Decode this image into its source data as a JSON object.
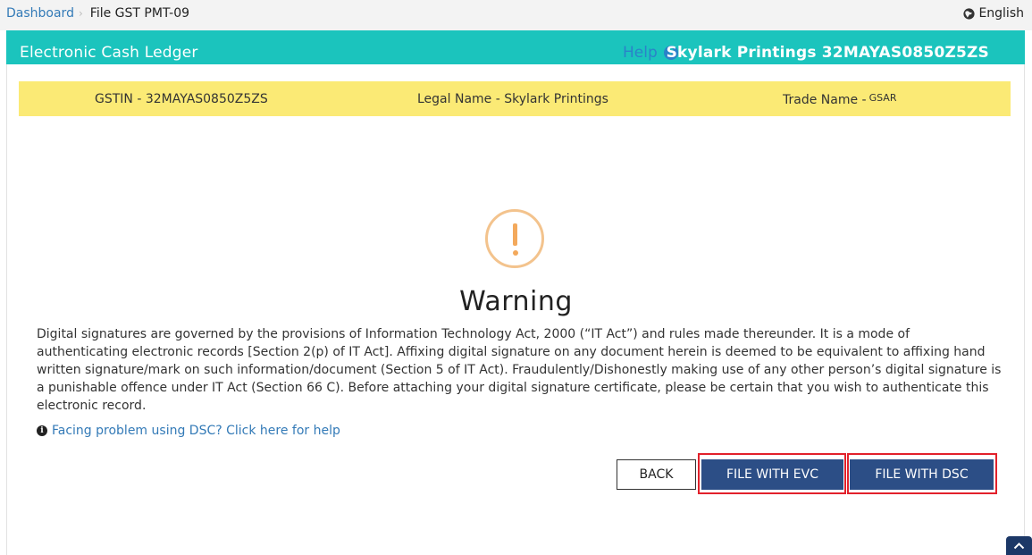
{
  "breadcrumb": {
    "home": "Dashboard",
    "separator": "›",
    "current": "File GST PMT-09"
  },
  "language": "English",
  "header": {
    "title": "Electronic Cash Ledger",
    "help": "Help",
    "help_icon": "?",
    "taxpayer": "Skylark Printings 32MAYAS0850Z5ZS"
  },
  "info": {
    "gstin": "GSTIN - 32MAYAS0850Z5ZS",
    "legal_name": "Legal Name - Skylark Printings",
    "trade_label": "Trade Name -",
    "trade_value": "GSAR"
  },
  "warning": {
    "title": "Warning",
    "text": "Digital signatures are governed by the provisions of Information Technology Act, 2000 (“IT Act”) and rules made thereunder. It is a mode of authenticating electronic records [Section 2(p) of IT Act]. Affixing digital signature on any document herein is deemed to be equivalent to affixing hand written signature/mark on such information/document (Section 5 of IT Act). Fraudulently/Dishonestly making use of any other person’s digital signature is a punishable offence under IT Act (Section 66 C). Before attaching your digital signature certificate, please be certain that you wish to authenticate this electronic record.",
    "info_glyph": "i",
    "help_link": "Facing problem using DSC? Click here for help"
  },
  "buttons": {
    "back": "BACK",
    "evc": "FILE WITH EVC",
    "dsc": "FILE WITH DSC"
  },
  "colors": {
    "header_bg": "#1bc4bd",
    "info_bg": "#fbea75",
    "primary_button": "#2c4e86",
    "highlight_border": "#e2212b",
    "warning_icon": "#f3a95c"
  },
  "icons": [
    "globe-icon",
    "help-icon",
    "warning-icon",
    "info-icon",
    "chevron-up-icon"
  ]
}
